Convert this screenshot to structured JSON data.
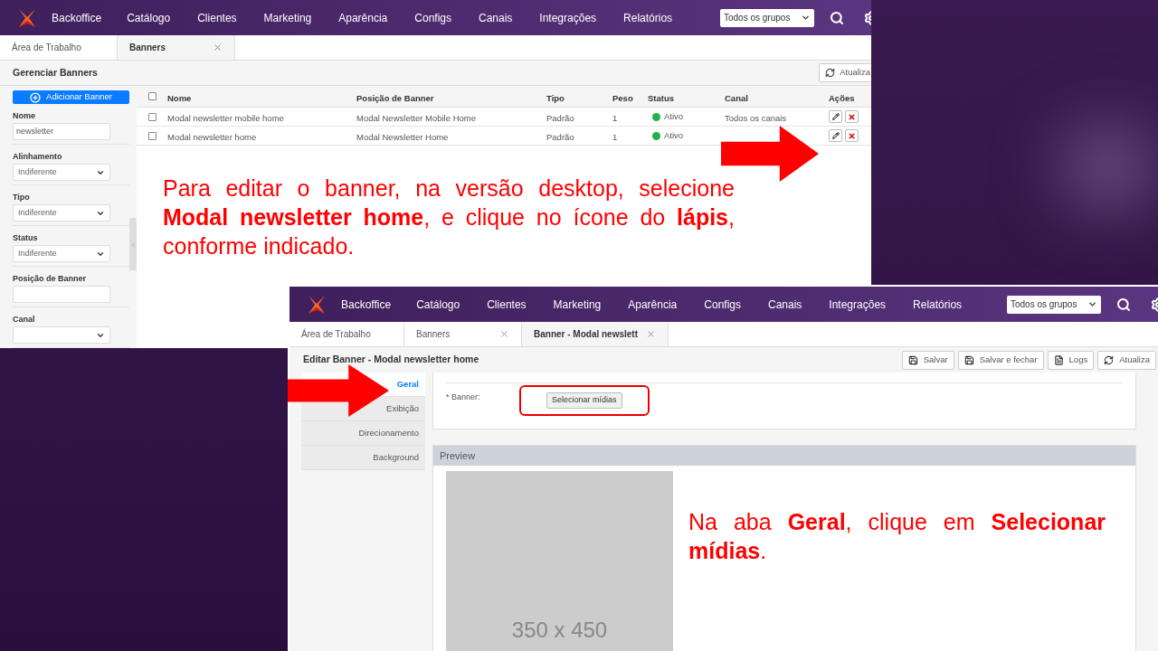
{
  "list_screen": {
    "nav": {
      "brand": "Backoffice",
      "items": [
        "Catálogo",
        "Clientes",
        "Marketing",
        "Aparência",
        "Configs",
        "Canais",
        "Integrações",
        "Relatórios"
      ],
      "group_select": "Todos os grupos"
    },
    "tabs": [
      {
        "label": "Área de Trabalho",
        "selected": false,
        "closable": false
      },
      {
        "label": "Banners",
        "selected": true,
        "closable": true
      }
    ],
    "title": "Gerenciar Banners",
    "refresh_button": "Atualiza",
    "add_button": "Adicionar Banner",
    "filters": [
      {
        "kind": "text",
        "label": "Nome",
        "value": "newsletter"
      },
      {
        "kind": "select",
        "label": "Alinhamento",
        "value": "Indiferente"
      },
      {
        "kind": "select",
        "label": "Tipo",
        "value": "Indiferente"
      },
      {
        "kind": "select",
        "label": "Status",
        "value": "Indiferente"
      },
      {
        "kind": "text",
        "label": "Posição de Banner"
      },
      {
        "kind": "select",
        "label": "Canal"
      }
    ],
    "table": {
      "all_checked": false,
      "columns": [
        "Nome",
        "Posição de Banner",
        "Tipo",
        "Peso",
        "Status",
        "Canal",
        "Ações"
      ],
      "rows": [
        {
          "checked": false,
          "name": "Modal newsletter mobile home",
          "position": "Modal Newsletter Mobile Home",
          "type": "Padrão",
          "weight": "1",
          "status": "Ativo",
          "color": "#22b14c",
          "channel": "Todos os canais"
        },
        {
          "checked": false,
          "name": "Modal newsletter home",
          "position": "Modal Newsletter Home",
          "type": "Padrão",
          "weight": "1",
          "status": "Ativo",
          "color": "#22b14c"
        }
      ]
    },
    "instruction": "Para editar o banner, na versão desktop, selecione **Modal newsletter home**, e clique no ícone do **lápis**, conforme indicado."
  },
  "edit_screen": {
    "nav": {
      "brand": "Backoffice",
      "items": [
        "Catálogo",
        "Clientes",
        "Marketing",
        "Aparência",
        "Configs",
        "Canais",
        "Integrações",
        "Relatórios"
      ],
      "group_select": "Todos os grupos"
    },
    "tabs": [
      {
        "label": "Área de Trabalho",
        "selected": false,
        "closable": false
      },
      {
        "label": "Banners",
        "selected": false,
        "closable": true
      },
      {
        "label": "Banner - Modal newslett",
        "selected": true,
        "closable": true
      }
    ],
    "title": "Editar Banner - Modal newsletter home",
    "toolbar": [
      {
        "kind": "save",
        "label": "Salvar"
      },
      {
        "kind": "save",
        "label": "Salvar e fechar"
      },
      {
        "kind": "document",
        "label": "Logs"
      },
      {
        "kind": "refresh",
        "label": "Atualiza"
      }
    ],
    "side_tabs": [
      {
        "label": "Geral",
        "selected": true
      },
      {
        "label": "Exibição",
        "selected": false
      },
      {
        "label": "Direcionamento",
        "selected": false
      },
      {
        "label": "Background",
        "selected": false
      }
    ],
    "field_label": "* Banner:",
    "media_button": "Selecionar mídias",
    "preview_title": "Preview",
    "placeholder_size": "350 x 450",
    "instruction": "Na aba **Geral**, clique em **Selecionar mídias**."
  }
}
